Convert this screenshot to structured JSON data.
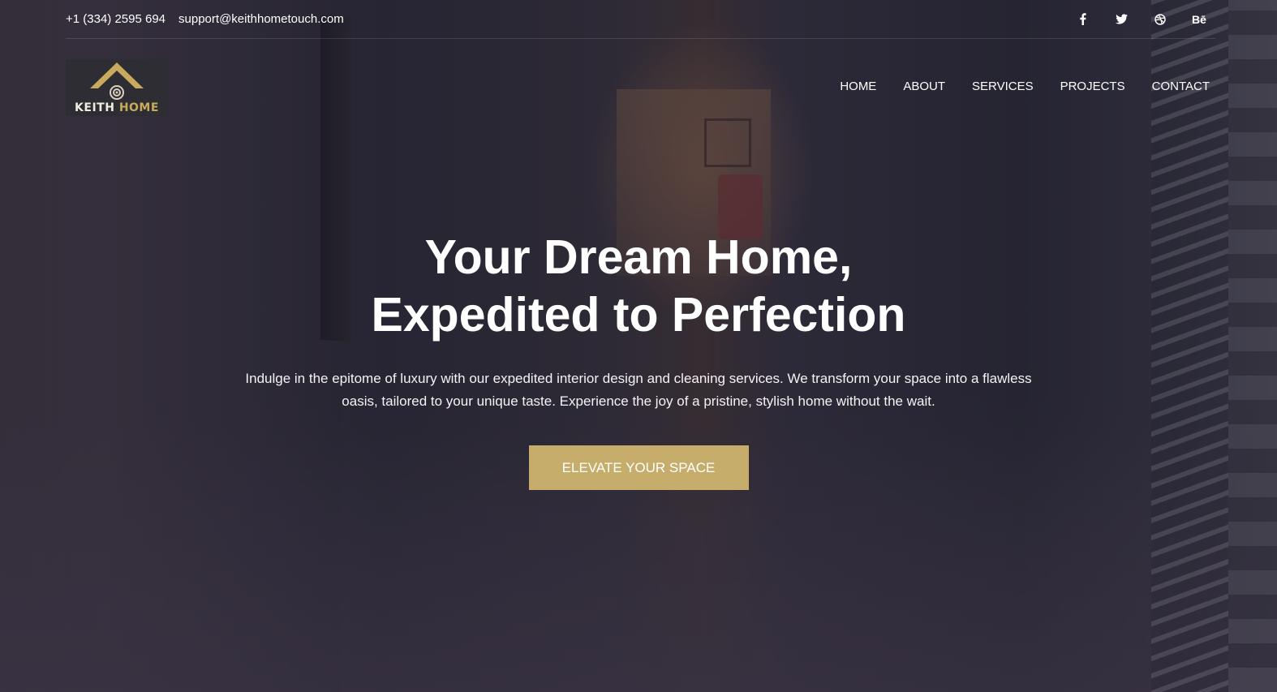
{
  "topbar": {
    "phone": "+1 (334) 2595 694",
    "email": "support@keithhometouch.com",
    "socials": [
      {
        "icon": "facebook-icon"
      },
      {
        "icon": "twitter-icon"
      },
      {
        "icon": "dribbble-icon"
      },
      {
        "icon": "behance-icon",
        "label": "Bē"
      }
    ]
  },
  "logo": {
    "word1": "KEITH",
    "word2": "HOME",
    "accent_color": "#c9a95b"
  },
  "nav": {
    "items": [
      "HOME",
      "ABOUT",
      "SERVICES",
      "PROJECTS",
      "CONTACT"
    ]
  },
  "hero": {
    "title_line1": "Your Dream Home,",
    "title_line2": "Expedited to Perfection",
    "description": "Indulge in the epitome of luxury with our expedited interior design and cleaning services. We transform your space into a flawless oasis, tailored to your unique taste. Experience the joy of a pristine, stylish home without the wait.",
    "cta_label": "ELEVATE YOUR SPACE",
    "cta_color": "#c6ad6b"
  }
}
